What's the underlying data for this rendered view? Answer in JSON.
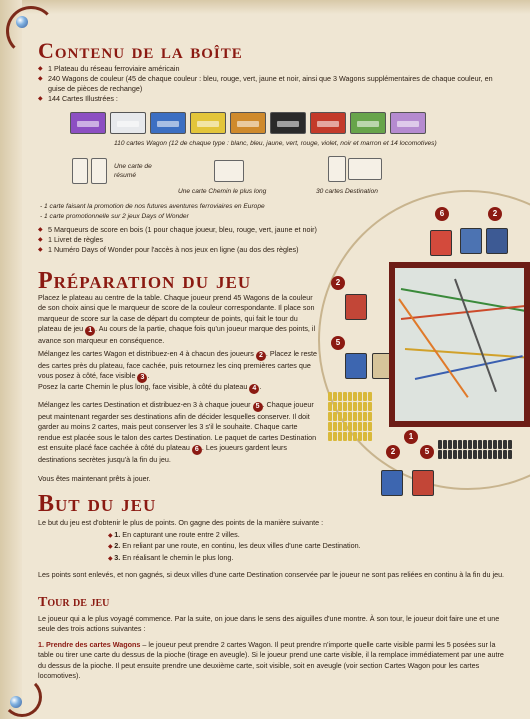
{
  "colors": {
    "accent": "#8b1a12",
    "text": "#2b1d12",
    "paper": "#efe6d3"
  },
  "contenu": {
    "title": "Contenu de la boîte",
    "items": [
      "1 Plateau du réseau ferroviaire américain",
      "240 Wagons de couleur (45 de chaque couleur : bleu, rouge, vert, jaune et noir, ainsi que 3 Wagons supplémentaires de chaque couleur, en guise de pièces de rechange)",
      "144 Cartes Illustrées :"
    ],
    "cards_caption": "110 cartes Wagon (12 de chaque type : blanc, bleu, jaune, vert, rouge, violet, noir et marron et 14 locomotives)",
    "card_colors": [
      "#8c4fc2",
      "#e7e9ec",
      "#3c6fc2",
      "#e3c53a",
      "#cf8a2c",
      "#2a2a2a",
      "#c33a2a",
      "#67a44b",
      "#b58bd0"
    ],
    "resume_label": "Une carte de résumé",
    "longest_label": "Une carte Chemin le plus long",
    "dest_label": "30 cartes Destination",
    "promo1": "- 1 carte faisant la promotion de nos futures aventures ferroviaires en Europe",
    "promo2": "- 1 carte promotionnelle sur 2 jeux Days of Wonder",
    "items2": [
      "5 Marqueurs de score en bois (1 pour chaque joueur, bleu, rouge, vert, jaune et noir)",
      "1 Livret de règles",
      "1 Numéro Days of Wonder pour l'accès à nos jeux en ligne (au dos des règles)"
    ]
  },
  "preparation": {
    "title": "Préparation du jeu",
    "p1a": "Placez le plateau au centre de la table. Chaque joueur prend 45 Wagons de la couleur de son choix ainsi que le marqueur de score de la couleur correspondante. Il place son marqueur de score sur la case de départ du compteur de points, qui fait le tour du plateau de jeu",
    "p1b": ". Au cours de la partie, chaque fois qu'un joueur marque des points, il avance son marqueur en conséquence.",
    "p2a": "Mélangez les cartes Wagon et distribuez-en 4 à chacun des joueurs",
    "p2b": ". Placez le reste des cartes près du plateau, face cachée, puis retournez les cinq premières cartes que vous posez à côté, face visible",
    "p3a": "Posez la carte Chemin le plus long, face visible, à côté du plateau",
    "p4a": "Mélangez les cartes Destination et distribuez-en 3 à chaque joueur",
    "p4b": ". Chaque joueur peut maintenant regarder ses destinations afin de décider lesquelles conserver. Il doit garder au moins 2 cartes, mais peut conserver les 3 s'il le souhaite. Chaque carte rendue est placée sous le talon des cartes Destination. Le paquet de cartes Destination est ensuite placé face cachée à côté du plateau",
    "p4c": ". Les joueurs gardent leurs destinations secrètes jusqu'à la fin du jeu.",
    "p5": "Vous êtes maintenant prêts à jouer.",
    "n1": "1",
    "n2": "2",
    "n3": "3",
    "n4": "4",
    "n5": "5",
    "n6": "6"
  },
  "but": {
    "title": "But du jeu",
    "intro": "Le but du jeu est d'obtenir le plus de points. On gagne des points de la manière suivante :",
    "list": [
      {
        "n": "1.",
        "t": " En capturant une route entre 2 villes."
      },
      {
        "n": "2.",
        "t": " En reliant par une route, en continu, les deux villes d'une carte Destination."
      },
      {
        "n": "3.",
        "t": " En réalisant le chemin le plus long."
      }
    ],
    "outro": "Les points sont enlevés, et non gagnés, si deux villes d'une carte Destination conservée par le joueur ne sont pas reliées en continu à la fin du jeu."
  },
  "tour": {
    "title": "Tour de jeu",
    "p1": "Le joueur qui a le plus voyagé commence. Par la suite, on joue dans le sens des aiguilles d'une montre. À son tour, le joueur doit faire une et une seule des trois actions suivantes :",
    "p2_label": "1. Prendre des cartes Wagons",
    "p2": " – le joueur peut prendre 2 cartes Wagon. Il peut prendre n'importe quelle carte visible parmi les 5 posées sur la table ou tirer une carte du dessus de la pioche (tirage en aveugle). Si le joueur prend une carte visible, il la remplace immédiatement par une autre du dessus de la pioche. Il peut ensuite prendre une deuxième carte, soit visible, soit en aveugle (voir section Cartes Wagon pour les cartes locomotives)."
  }
}
